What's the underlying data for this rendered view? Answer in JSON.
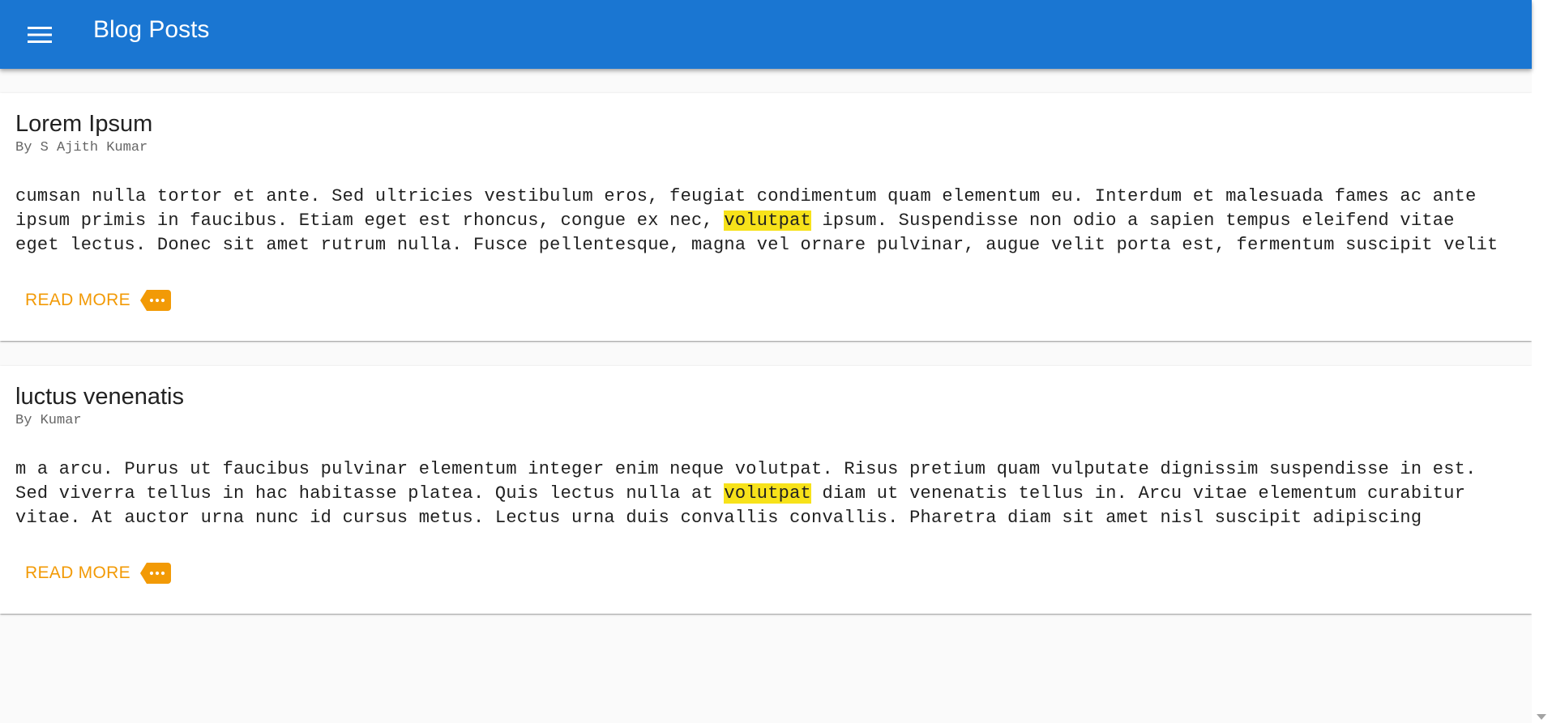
{
  "app_bar": {
    "menu_icon": "menu-icon",
    "title": "Blog Posts",
    "color": "#1a76d2"
  },
  "posts": [
    {
      "title": "Lorem Ipsum",
      "author": "By S Ajith Kumar",
      "lines": [
        [
          "cumsan nulla tortor et ante. Sed ultricies vestibulum eros, feugiat condimentum quam elementum eu. Interdum et malesuada fames ac ante"
        ],
        [
          "ipsum primis in faucibus. Etiam eget est rhoncus, congue ex nec, ",
          "volutpat",
          " ipsum. Suspendisse non odio a sapien tempus eleifend vitae"
        ],
        [
          "eget lectus. Donec sit amet rutrum nulla. Fusce pellentesque, magna vel ornare pulvinar, augue velit porta est, fermentum suscipit velit"
        ]
      ],
      "highlight": "volutpat",
      "read_more": "READ MORE",
      "read_more_icon": "more-tag-icon"
    },
    {
      "title": "luctus venenatis",
      "author": "By Kumar",
      "lines": [
        [
          "m a arcu. Purus ut faucibus pulvinar elementum integer enim neque volutpat. Risus pretium quam vulputate dignissim suspendisse in est."
        ],
        [
          "Sed viverra tellus in hac habitasse platea. Quis lectus nulla at ",
          "volutpat",
          " diam ut venenatis tellus in. Arcu vitae elementum curabitur"
        ],
        [
          "vitae. At auctor urna nunc id cursus metus. Lectus urna duis convallis convallis. Pharetra diam sit amet nisl suscipit adipiscing"
        ]
      ],
      "highlight": "volutpat",
      "read_more": "READ MORE",
      "read_more_icon": "more-tag-icon"
    }
  ],
  "colors": {
    "accent": "#f29a06",
    "highlight": "#f7e21a"
  }
}
